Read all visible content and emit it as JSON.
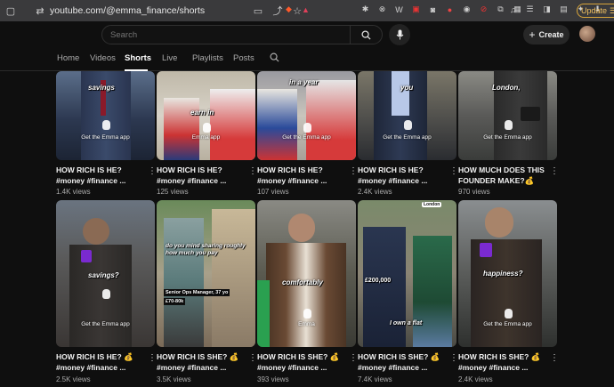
{
  "browser": {
    "url": "youtube.com/@emma_finance/shorts",
    "update_label": "Update"
  },
  "header": {
    "search_placeholder": "Search",
    "create_label": "Create"
  },
  "tabs": [
    {
      "label": "Home",
      "active": false
    },
    {
      "label": "Videos",
      "active": false
    },
    {
      "label": "Shorts",
      "active": true
    },
    {
      "label": "Live",
      "active": false
    },
    {
      "label": "Playlists",
      "active": false
    },
    {
      "label": "Posts",
      "active": false
    }
  ],
  "row1": [
    {
      "caption": "savings",
      "app": "Get the Emma app",
      "title": "HOW RICH IS HE? #money #finance ...",
      "views": "1.4K views"
    },
    {
      "caption": "earn in",
      "app": "Emma app",
      "title": "HOW RICH IS HE? #money #finance ...",
      "views": "125 views"
    },
    {
      "caption": "in a year",
      "app": "Get the Emma app",
      "title": "HOW RICH IS HE? #money #finance ...",
      "views": "107 views"
    },
    {
      "caption": "you",
      "app": "Get the Emma app",
      "title": "HOW RICH IS HE? #money #finance ...",
      "views": "2.4K views"
    },
    {
      "caption": "London,",
      "app": "Get the Emma app",
      "title": "HOW MUCH DOES THIS FOUNDER MAKE?💰",
      "views": "970 views"
    }
  ],
  "row2": [
    {
      "caption": "savings?",
      "app": "Get the Emma app",
      "title": "HOW RICH IS HE? 💰 #money #finance ...",
      "views": "2.5K views"
    },
    {
      "caption": "do you mind sharing roughly how much you pay",
      "app": "",
      "badge1": "Senior Ops Manager, 37 yo",
      "badge2": "£70-80k",
      "title": "HOW RICH IS SHE? 💰 #money #finance ...",
      "views": "3.5K views"
    },
    {
      "caption": "comfortably",
      "app": "Emma",
      "title": "HOW RICH IS SHE? 💰 #money #finance ...",
      "views": "393 views"
    },
    {
      "caption": "I own a flat",
      "app": "",
      "badge1": "£200,000",
      "location": "London",
      "title": "HOW RICH IS SHE? 💰 #money #finance ...",
      "views": "7.4K views"
    },
    {
      "caption": "happiness?",
      "app": "Get the Emma app",
      "title": "HOW RICH IS SHE? 💰 #money #finance ...",
      "views": "2.4K views"
    }
  ]
}
